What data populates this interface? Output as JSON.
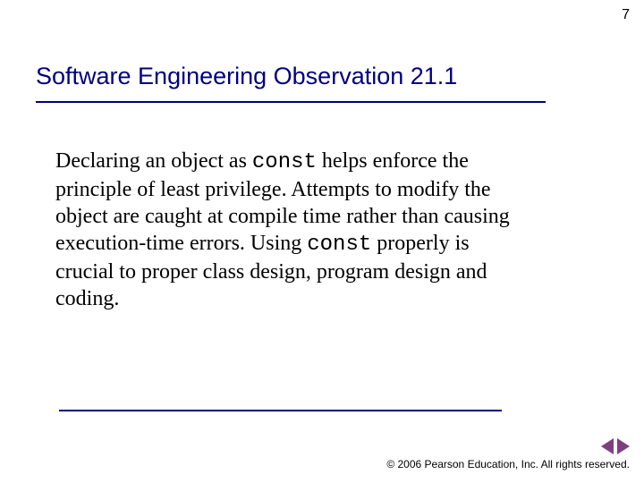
{
  "page_number": "7",
  "title": "Software Engineering Observation 21.1",
  "body": {
    "pre1": "Declaring an object as ",
    "kw1": "const",
    "mid1": " helps enforce the principle of least privilege. Attempts to modify the object are caught at compile time rather than causing execution-time errors. Using ",
    "kw2": "const",
    "post1": " properly is crucial to proper class design, program design and coding."
  },
  "footer": "© 2006 Pearson Education, Inc. All rights reserved.",
  "nav": {
    "prev": "previous-slide",
    "next": "next-slide"
  },
  "colors": {
    "accent": "#000080",
    "nav": "#7f3f7f"
  }
}
